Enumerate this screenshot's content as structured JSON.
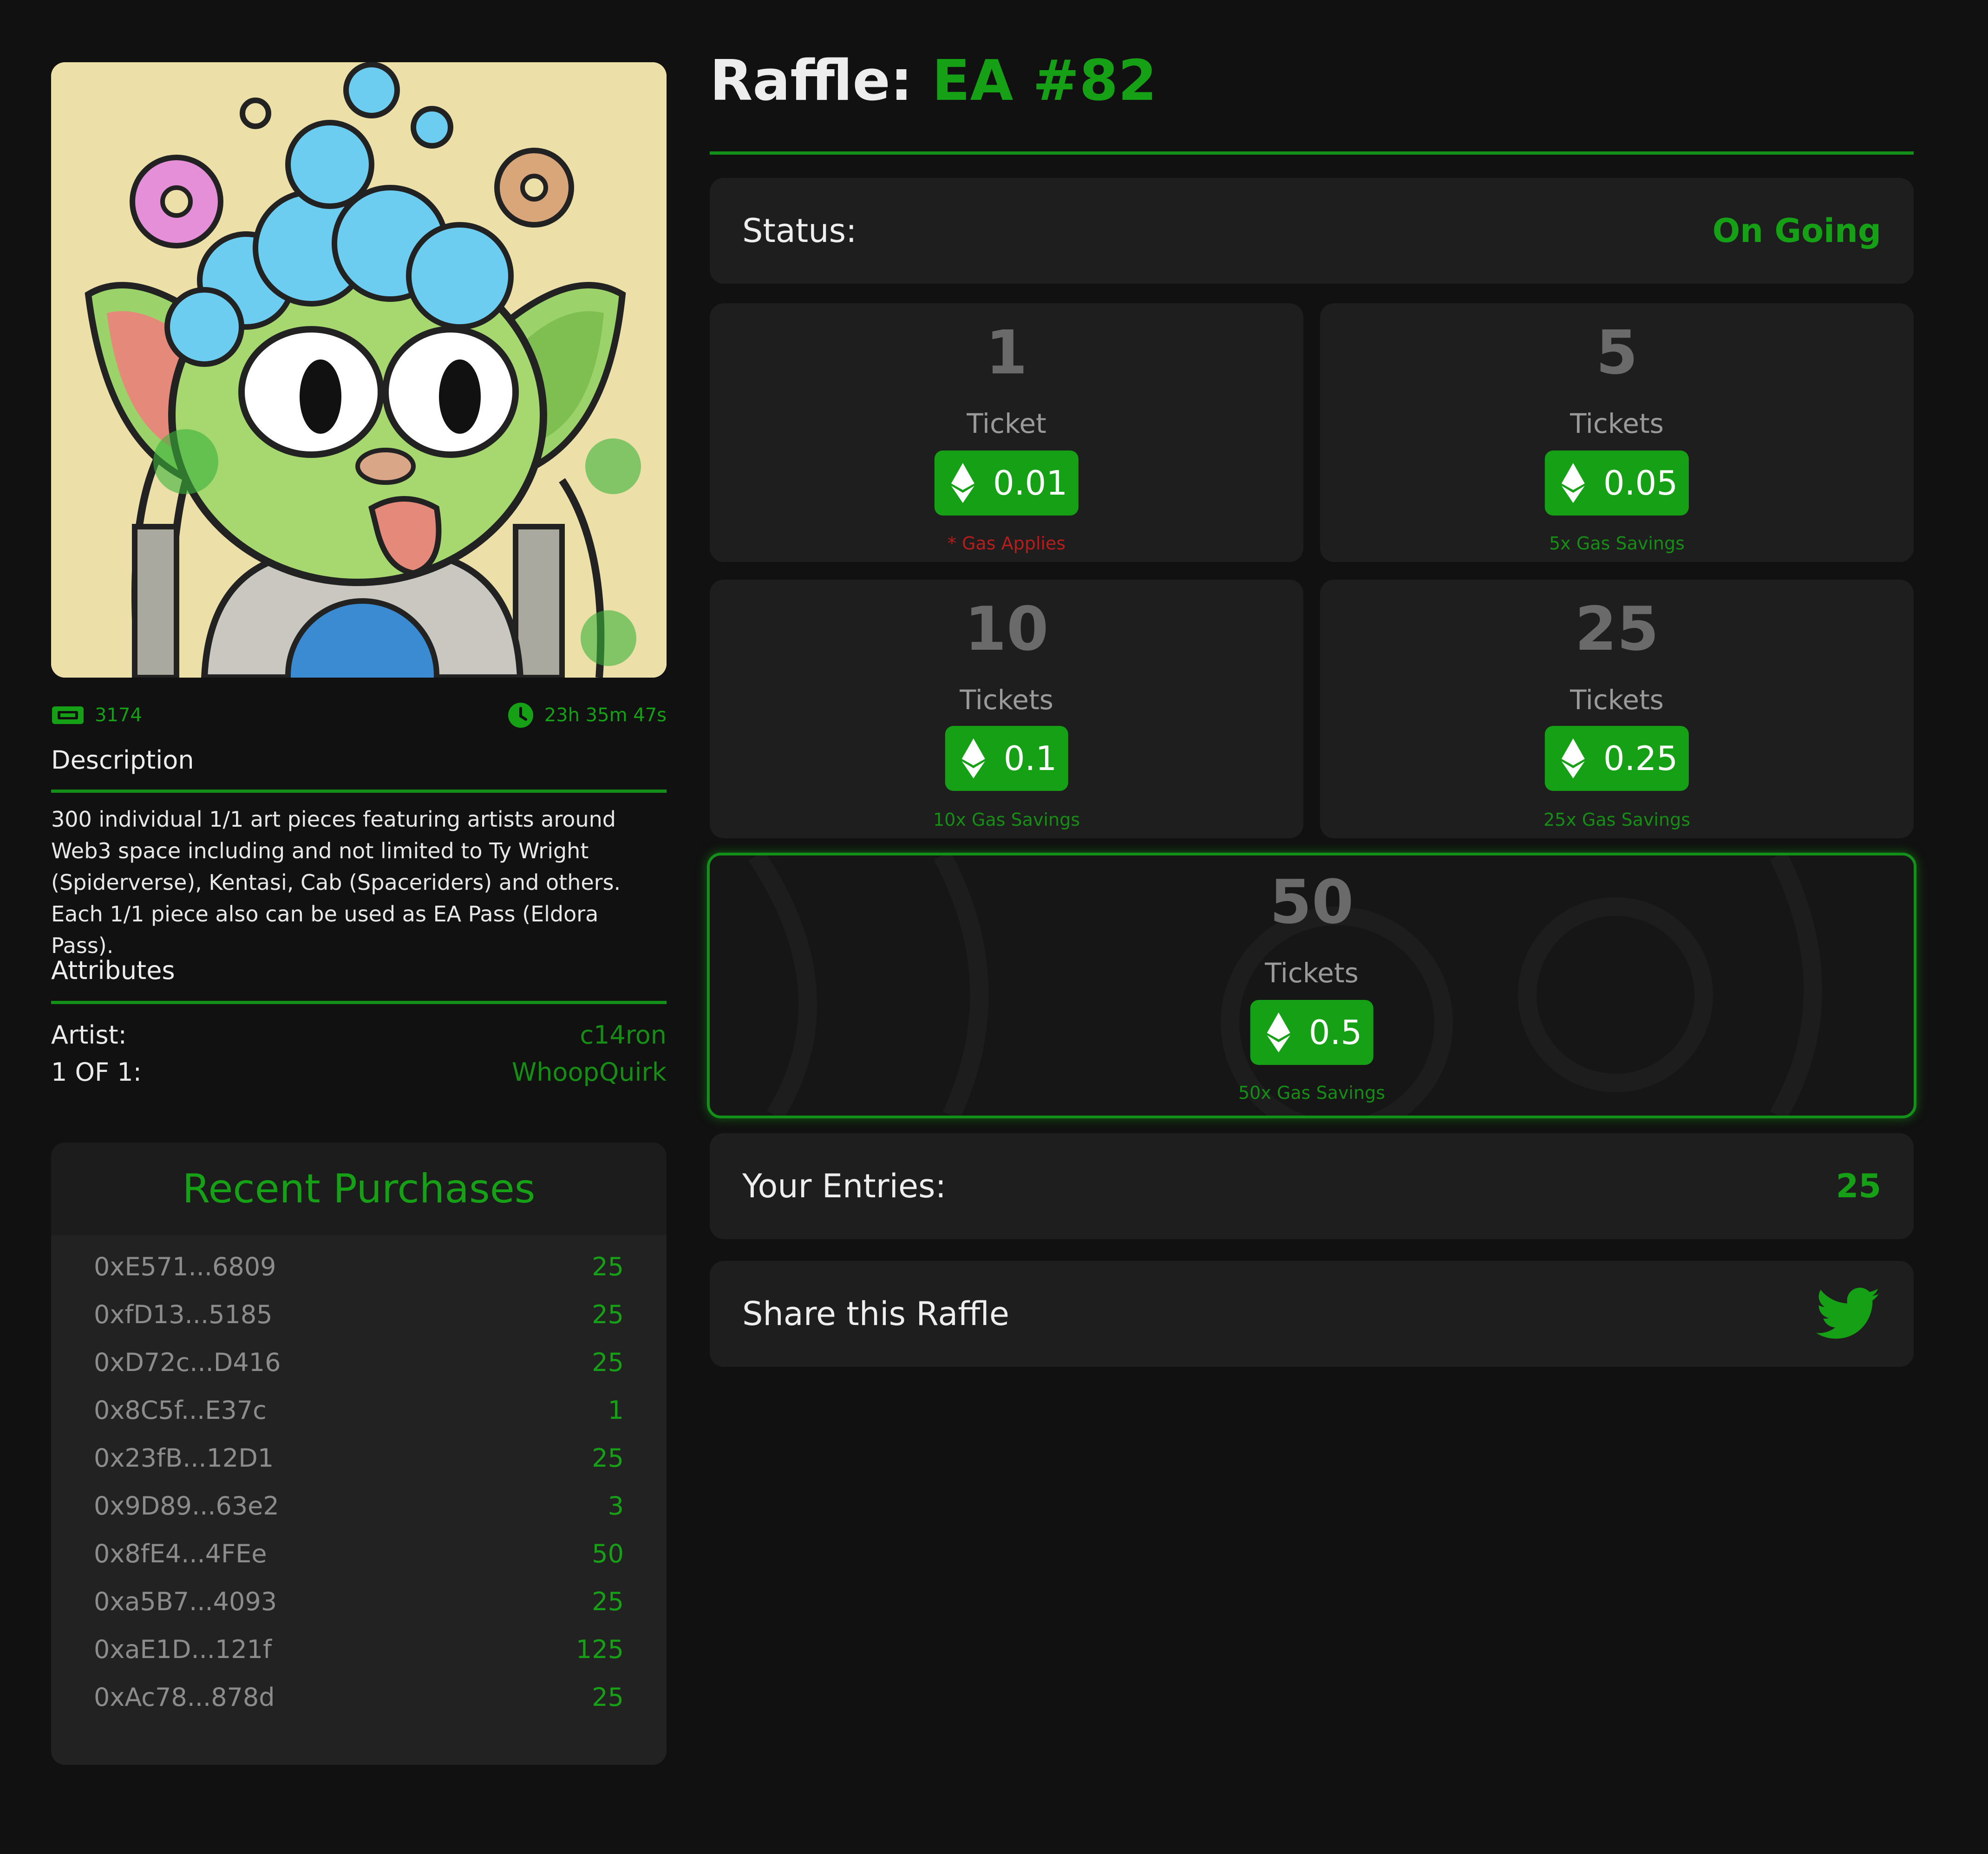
{
  "raffle": {
    "title_prefix": "Raffle:",
    "title_name": "EA #82",
    "status_label": "Status:",
    "status_value": "On Going",
    "ticket_count": "3174",
    "time_left": "23h 35m 47s"
  },
  "description": {
    "heading": "Description",
    "text": "300 individual 1/1 art pieces featuring artists around Web3 space including and not limited to Ty Wright (Spiderverse), Kentasi, Cab (Spaceriders) and others. Each 1/1 piece also can be used as EA Pass (Eldora Pass)."
  },
  "attributes": {
    "heading": "Attributes",
    "items": [
      {
        "key": "Artist:",
        "value": "c14ron"
      },
      {
        "key": "1 OF 1:",
        "value": "WhoopQuirk"
      }
    ]
  },
  "recent_purchases": {
    "heading": "Recent Purchases",
    "rows": [
      {
        "address": "0xE571...6809",
        "count": "25"
      },
      {
        "address": "0xfD13...5185",
        "count": "25"
      },
      {
        "address": "0xD72c...D416",
        "count": "25"
      },
      {
        "address": "0x8C5f...E37c",
        "count": "1"
      },
      {
        "address": "0x23fB...12D1",
        "count": "25"
      },
      {
        "address": "0x9D89...63e2",
        "count": "3"
      },
      {
        "address": "0x8fE4...4FEe",
        "count": "50"
      },
      {
        "address": "0xa5B7...4093",
        "count": "25"
      },
      {
        "address": "0xaE1D...121f",
        "count": "125"
      },
      {
        "address": "0xAc78...878d",
        "count": "25"
      }
    ]
  },
  "tickets": [
    {
      "qty": "1",
      "label": "Ticket",
      "price": "0.01",
      "note": "* Gas Applies"
    },
    {
      "qty": "5",
      "label": "Tickets",
      "price": "0.05",
      "note": "5x Gas Savings"
    },
    {
      "qty": "10",
      "label": "Tickets",
      "price": "0.1",
      "note": "10x Gas Savings"
    },
    {
      "qty": "25",
      "label": "Tickets",
      "price": "0.25",
      "note": "25x Gas Savings"
    },
    {
      "qty": "50",
      "label": "Tickets",
      "price": "0.5",
      "note": "50x Gas Savings"
    }
  ],
  "entries": {
    "label": "Your Entries:",
    "value": "25"
  },
  "share": {
    "label": "Share this Raffle",
    "icon": "twitter-icon"
  },
  "icons": {
    "ticket": "ticket-icon",
    "clock": "clock-icon",
    "price": "ethereum-icon"
  },
  "colors": {
    "accent": "#16a016",
    "background": "#111111",
    "panel": "#1e1e1e",
    "warning": "#b81d1d"
  }
}
